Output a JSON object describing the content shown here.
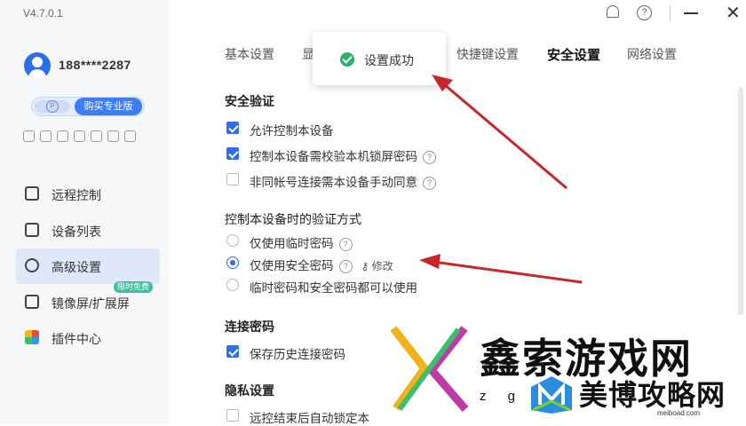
{
  "app": {
    "version": "V4.7.0.1"
  },
  "user": {
    "name": "188****2287"
  },
  "sidebar": {
    "buy_button": "购买专业版",
    "nav": [
      {
        "label": "远程控制",
        "icon": "monitor-icon",
        "active": false
      },
      {
        "label": "设备列表",
        "icon": "devices-icon",
        "active": false
      },
      {
        "label": "高级设置",
        "icon": "settings-icon",
        "active": true
      },
      {
        "label": "镜像屏/扩展屏",
        "icon": "mirror-screen-icon",
        "active": false,
        "badge": "限时免费"
      },
      {
        "label": "插件中心",
        "icon": "plugin-icon",
        "active": false
      }
    ]
  },
  "tabs": [
    {
      "label": "基本设置",
      "active": false
    },
    {
      "label": "显",
      "active": false
    },
    {
      "label": "快捷键设置",
      "active": false
    },
    {
      "label": "安全设置",
      "active": true
    },
    {
      "label": "网络设置",
      "active": false
    }
  ],
  "toast": {
    "message": "设置成功"
  },
  "security": {
    "section_title": "安全验证",
    "options": [
      {
        "label": "允许控制本设备",
        "checked": true,
        "help": false
      },
      {
        "label": "控制本设备需校验本机锁屏密码",
        "checked": true,
        "help": true
      },
      {
        "label": "非同帐号连接需本设备手动同意",
        "checked": false,
        "help": true
      }
    ]
  },
  "verify": {
    "section_title": "控制本设备时的验证方式",
    "options": [
      {
        "label": "仅使用临时密码",
        "selected": false,
        "help": true
      },
      {
        "label": "仅使用安全密码",
        "selected": true,
        "help": true,
        "action": "修改"
      },
      {
        "label": "临时密码和安全密码都可以使用",
        "selected": false,
        "help": false
      }
    ]
  },
  "connect_password": {
    "section_title": "连接密码",
    "option": {
      "label": "保存历史连接密码",
      "checked": true
    }
  },
  "privacy": {
    "section_title": "隐私设置",
    "option": {
      "label": "远控结束后自动锁定本",
      "checked": false
    }
  },
  "watermark": {
    "title": "鑫索游戏网",
    "zg": "z g",
    "subtitle": "美博攻略网",
    "url": "meiboad.com"
  },
  "colors": {
    "accent": "#2f6fe6",
    "success": "#27b36b",
    "arrow": "#c8262c"
  }
}
